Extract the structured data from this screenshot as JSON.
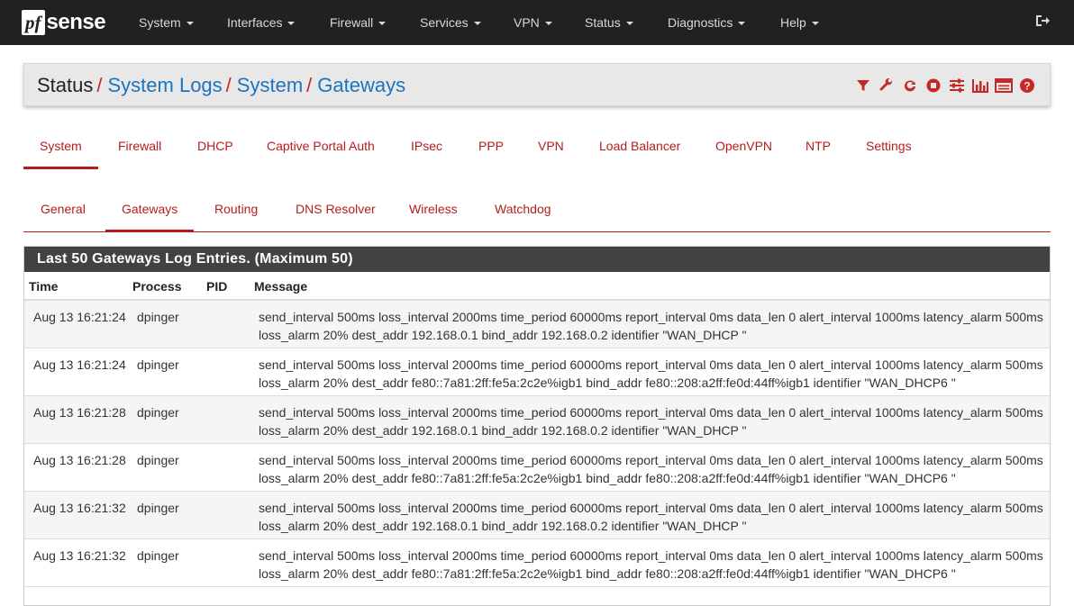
{
  "brand": {
    "logo_pf": "pf",
    "logo_sense": "sense"
  },
  "nav": [
    {
      "label": "System"
    },
    {
      "label": "Interfaces"
    },
    {
      "label": "Firewall"
    },
    {
      "label": "Services"
    },
    {
      "label": "VPN"
    },
    {
      "label": "Status"
    },
    {
      "label": "Diagnostics"
    },
    {
      "label": "Help"
    }
  ],
  "breadcrumb": {
    "status": "Status",
    "system_logs": "System Logs",
    "system": "System",
    "gateways": "Gateways",
    "sep": "/"
  },
  "toolbar_icons": [
    "filter-icon",
    "wrench-icon",
    "refresh-icon",
    "stop-icon",
    "sliders-icon",
    "bar-chart-icon",
    "list-icon",
    "help-icon"
  ],
  "tabs_primary": [
    {
      "label": "System"
    },
    {
      "label": "Firewall"
    },
    {
      "label": "DHCP"
    },
    {
      "label": "Captive Portal Auth"
    },
    {
      "label": "IPsec"
    },
    {
      "label": "PPP"
    },
    {
      "label": "VPN"
    },
    {
      "label": "Load Balancer"
    },
    {
      "label": "OpenVPN"
    },
    {
      "label": "NTP"
    },
    {
      "label": "Settings"
    }
  ],
  "tabs_secondary": [
    {
      "label": "General"
    },
    {
      "label": "Gateways"
    },
    {
      "label": "Routing"
    },
    {
      "label": "DNS Resolver"
    },
    {
      "label": "Wireless"
    },
    {
      "label": "Watchdog"
    }
  ],
  "panel": {
    "title": "Last 50 Gateways Log Entries. (Maximum 50)",
    "columns": {
      "time": "Time",
      "process": "Process",
      "pid": "PID",
      "message": "Message"
    },
    "rows": [
      {
        "time": "Aug 13 16:21:24",
        "process": "dpinger",
        "pid": "",
        "line1": "send_interval 500ms loss_interval 2000ms time_period 60000ms report_interval 0ms data_len 0 alert_interval 1000ms latency_alarm 500ms",
        "line2": "loss_alarm 20% dest_addr 192.168.0.1 bind_addr 192.168.0.2 identifier \"WAN_DHCP \""
      },
      {
        "time": "Aug 13 16:21:24",
        "process": "dpinger",
        "pid": "",
        "line1": "send_interval 500ms loss_interval 2000ms time_period 60000ms report_interval 0ms data_len 0 alert_interval 1000ms latency_alarm 500ms",
        "line2": "loss_alarm 20% dest_addr fe80::7a81:2ff:fe5a:2c2e%igb1 bind_addr fe80::208:a2ff:fe0d:44ff%igb1 identifier \"WAN_DHCP6 \""
      },
      {
        "time": "Aug 13 16:21:28",
        "process": "dpinger",
        "pid": "",
        "line1": "send_interval 500ms loss_interval 2000ms time_period 60000ms report_interval 0ms data_len 0 alert_interval 1000ms latency_alarm 500ms",
        "line2": "loss_alarm 20% dest_addr 192.168.0.1 bind_addr 192.168.0.2 identifier \"WAN_DHCP \""
      },
      {
        "time": "Aug 13 16:21:28",
        "process": "dpinger",
        "pid": "",
        "line1": "send_interval 500ms loss_interval 2000ms time_period 60000ms report_interval 0ms data_len 0 alert_interval 1000ms latency_alarm 500ms",
        "line2": "loss_alarm 20% dest_addr fe80::7a81:2ff:fe5a:2c2e%igb1 bind_addr fe80::208:a2ff:fe0d:44ff%igb1 identifier \"WAN_DHCP6 \""
      },
      {
        "time": "Aug 13 16:21:32",
        "process": "dpinger",
        "pid": "",
        "line1": "send_interval 500ms loss_interval 2000ms time_period 60000ms report_interval 0ms data_len 0 alert_interval 1000ms latency_alarm 500ms",
        "line2": "loss_alarm 20% dest_addr 192.168.0.1 bind_addr 192.168.0.2 identifier \"WAN_DHCP \""
      },
      {
        "time": "Aug 13 16:21:32",
        "process": "dpinger",
        "pid": "",
        "line1": "send_interval 500ms loss_interval 2000ms time_period 60000ms report_interval 0ms data_len 0 alert_interval 1000ms latency_alarm 500ms",
        "line2": "loss_alarm 20% dest_addr fe80::7a81:2ff:fe5a:2c2e%igb1 bind_addr fe80::208:a2ff:fe0d:44ff%igb1 identifier \"WAN_DHCP6 \""
      }
    ]
  },
  "colors": {
    "navbar": "#212121",
    "accent": "#b71c1c",
    "link": "#1e73be",
    "panel_heading": "#424242"
  }
}
